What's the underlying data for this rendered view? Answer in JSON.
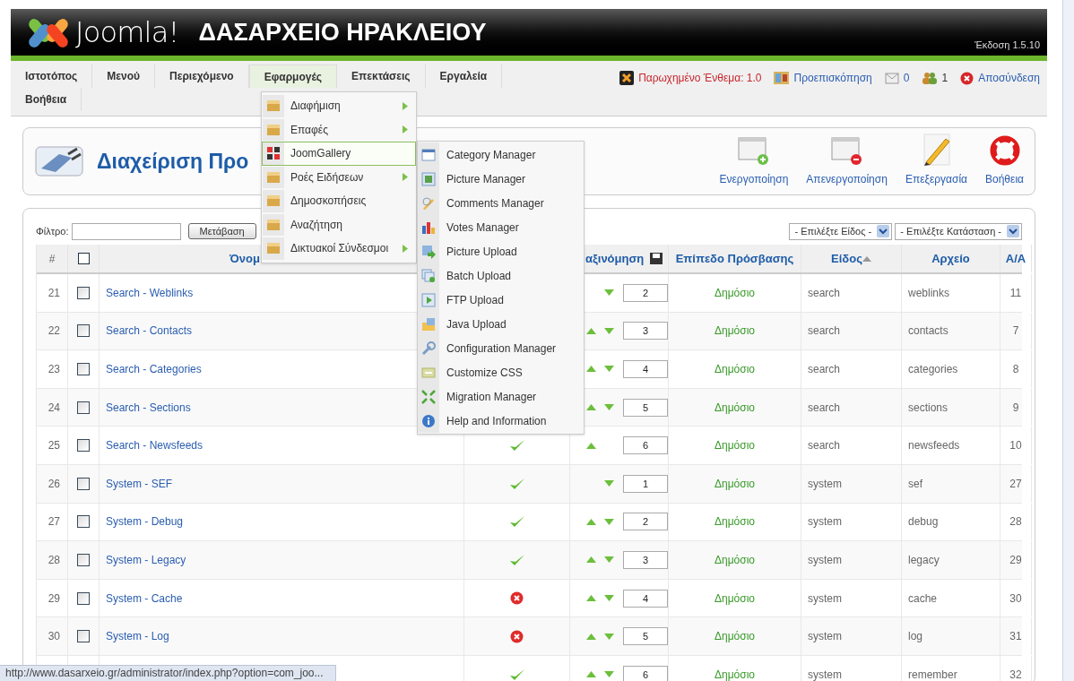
{
  "header": {
    "logo_text": "Joomla!",
    "site_title": "ΔΑΣΑΡΧΕΙΟ ΗΡΑΚΛΕΙΟΥ",
    "version": "Έκδοση 1.5.10"
  },
  "menu_bar": {
    "items": [
      {
        "label": "Ιστοτόπος",
        "selected": false
      },
      {
        "label": "Μενού",
        "selected": false
      },
      {
        "label": "Περιεχόμενο",
        "selected": false
      },
      {
        "label": "Εφαρμογές",
        "selected": true
      },
      {
        "label": "Επεκτάσεις",
        "selected": false
      },
      {
        "label": "Εργαλεία",
        "selected": false
      },
      {
        "label": "Βοήθεια",
        "selected": false
      }
    ],
    "status": [
      {
        "kind": "legacy",
        "text": "Παρωχημένο Ένθεμα: 1.0"
      },
      {
        "kind": "preview",
        "text": "Προεπισκόπηση"
      },
      {
        "kind": "messages",
        "text": "0"
      },
      {
        "kind": "users",
        "text": "1"
      },
      {
        "kind": "logout",
        "text": "Αποσύνδεση"
      }
    ]
  },
  "dropdown": {
    "items": [
      {
        "label": "Διαφήμιση",
        "has_submenu": true,
        "selected": false
      },
      {
        "label": "Επαφές",
        "has_submenu": true,
        "selected": false
      },
      {
        "label": "JoomGallery",
        "has_submenu": false,
        "selected": true
      },
      {
        "label": "Ροές Ειδήσεων",
        "has_submenu": true,
        "selected": false
      },
      {
        "label": "Δημοσκοπήσεις",
        "has_submenu": false,
        "selected": false
      },
      {
        "label": "Αναζήτηση",
        "has_submenu": false,
        "selected": false
      },
      {
        "label": "Δικτυακοί Σύνδεσμοι",
        "has_submenu": true,
        "selected": false
      }
    ]
  },
  "submenu": {
    "items": [
      "Category Manager",
      "Picture Manager",
      "Comments Manager",
      "Votes Manager",
      "Picture Upload",
      "Batch Upload",
      "FTP Upload",
      "Java Upload",
      "Configuration Manager",
      "Customize CSS",
      "Migration Manager",
      "Help and Information"
    ]
  },
  "toolbar": {
    "title": "Διαχείριση Προ",
    "buttons": [
      {
        "kind": "enable",
        "label": "Ενεργοποίηση"
      },
      {
        "kind": "disable",
        "label": "Απενεργοποίηση"
      },
      {
        "kind": "edit",
        "label": "Επεξεργασία"
      },
      {
        "kind": "help",
        "label": "Βοήθεια"
      }
    ]
  },
  "filter": {
    "label": "Φίλτρο:",
    "go_button": "Μετάβαση",
    "type_select": "- Επιλέξτε Είδος -",
    "state_select": "- Επιλέξτε Κατάσταση -"
  },
  "table": {
    "header_checkbox": {
      "checked": false
    },
    "columns": [
      {
        "label": "#",
        "sorted": false
      },
      {
        "label": "Όνομ",
        "sorted": false
      },
      {
        "label": "αξινόμηση",
        "sorted": false
      },
      {
        "label": "Επίπεδο Πρόσβασης",
        "sorted": false
      },
      {
        "label": "Είδος",
        "sorted": true
      },
      {
        "label": "Αρχείο",
        "sorted": false
      },
      {
        "label": "Α/Α",
        "sorted": false
      }
    ],
    "rows": [
      {
        "number": "21",
        "checked": false,
        "name": "Search - Weblinks",
        "up": false,
        "down": true,
        "order": "2",
        "access": "Δημόσιο",
        "type": "search",
        "file": "weblinks",
        "id": "11"
      },
      {
        "number": "22",
        "checked": false,
        "name": "Search - Contacts",
        "up": true,
        "down": true,
        "order": "3",
        "access": "Δημόσιο",
        "type": "search",
        "file": "contacts",
        "id": "7"
      },
      {
        "number": "23",
        "checked": false,
        "name": "Search - Categories",
        "up": true,
        "down": true,
        "order": "4",
        "access": "Δημόσιο",
        "type": "search",
        "file": "categories",
        "id": "8"
      },
      {
        "number": "24",
        "checked": false,
        "name": "Search - Sections",
        "up": true,
        "down": true,
        "order": "5",
        "access": "Δημόσιο",
        "type": "search",
        "file": "sections",
        "id": "9"
      },
      {
        "number": "25",
        "checked": false,
        "name": "Search - Newsfeeds",
        "enabled": true,
        "up": true,
        "down": false,
        "order": "6",
        "access": "Δημόσιο",
        "type": "search",
        "file": "newsfeeds",
        "id": "10"
      },
      {
        "number": "26",
        "checked": false,
        "name": "System - SEF",
        "enabled": true,
        "up": false,
        "down": true,
        "order": "1",
        "access": "Δημόσιο",
        "type": "system",
        "file": "sef",
        "id": "27"
      },
      {
        "number": "27",
        "checked": false,
        "name": "System - Debug",
        "enabled": true,
        "up": true,
        "down": true,
        "order": "2",
        "access": "Δημόσιο",
        "type": "system",
        "file": "debug",
        "id": "28"
      },
      {
        "number": "28",
        "checked": false,
        "name": "System - Legacy",
        "enabled": true,
        "up": true,
        "down": true,
        "order": "3",
        "access": "Δημόσιο",
        "type": "system",
        "file": "legacy",
        "id": "29"
      },
      {
        "number": "29",
        "checked": false,
        "name": "System - Cache",
        "enabled": false,
        "up": true,
        "down": true,
        "order": "4",
        "access": "Δημόσιο",
        "type": "system",
        "file": "cache",
        "id": "30"
      },
      {
        "number": "30",
        "checked": false,
        "name": "System - Log",
        "enabled": false,
        "up": true,
        "down": true,
        "order": "5",
        "access": "Δημόσιο",
        "type": "system",
        "file": "log",
        "id": "31"
      },
      {
        "enabled": true,
        "up": true,
        "down": true,
        "order": "6",
        "access": "Δημόσιο",
        "type": "system",
        "file": "remember",
        "id": "32"
      }
    ]
  },
  "status_bar": "http://www.dasarxeio.gr/administrator/index.php?option=com_joo..."
}
